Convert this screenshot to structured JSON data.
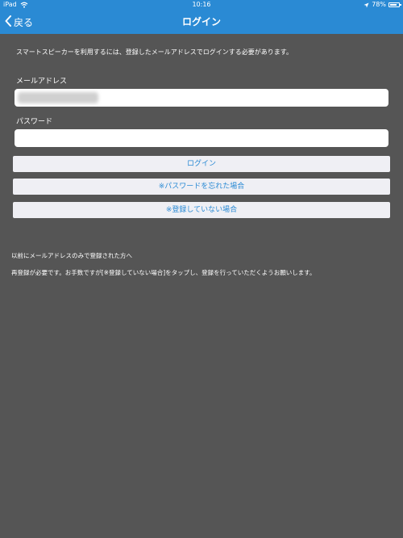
{
  "status_bar": {
    "device": "iPad",
    "time": "10:16",
    "battery": "78%",
    "battery_level": 0.78
  },
  "nav": {
    "back_label": "戻る",
    "title": "ログイン"
  },
  "description": "スマートスピーカーを利用するには、登録したメールアドレスでログインする必要があります。",
  "form": {
    "email_label": "メールアドレス",
    "email_value": "",
    "password_label": "パスワード",
    "password_value": ""
  },
  "buttons": {
    "login": "ログイン",
    "forgot_password": "※パスワードを忘れた場合",
    "register": "※登録していない場合"
  },
  "notice": {
    "heading": "以前にメールアドレスのみで登録された方へ",
    "body": "再登録が必要です。お手数ですが[※登録していない場合]をタップし、登録を行っていただくようお願いします。"
  },
  "colors": {
    "accent": "#2a8ad4",
    "background": "#555555",
    "button_background": "#efeff4"
  }
}
